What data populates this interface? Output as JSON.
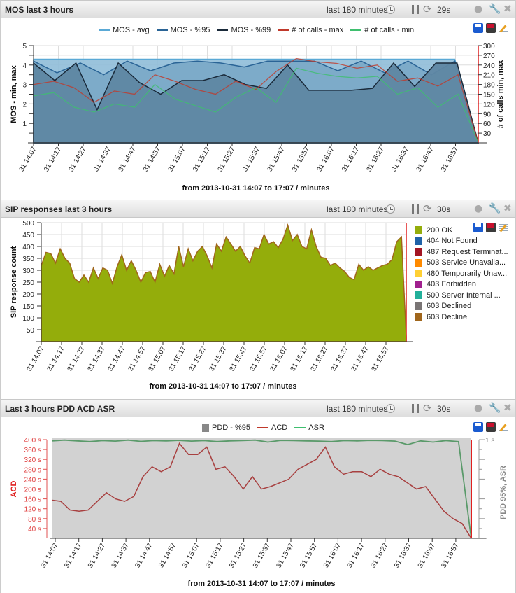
{
  "panels": [
    {
      "title": "MOS last 3 hours",
      "range_label": "last 180 minutes",
      "refresh_label": "29s"
    },
    {
      "title": "SIP responses last 3 hours",
      "range_label": "last 180 minutes",
      "refresh_label": "30s"
    },
    {
      "title": "Last 3 hours PDD ACD ASR",
      "range_label": "last 180 minutes",
      "refresh_label": "30s"
    }
  ],
  "chart_data": [
    {
      "type": "area",
      "title": "MOS last 3 hours",
      "xlabel": "from 2013-10-31 14:07 to 17:07 / minutes",
      "ylabel": "MOS - min, max",
      "y2label": "# of calls min, max",
      "ylim": [
        0,
        5
      ],
      "y2lim": [
        0,
        300
      ],
      "yticks": [
        "1",
        "2",
        "3",
        "4",
        "5"
      ],
      "y2ticks": [
        "30",
        "60",
        "90",
        "120",
        "150",
        "180",
        "210",
        "240",
        "270",
        "300"
      ],
      "categories": [
        "31 14:07",
        "31 14:17",
        "31 14:27",
        "31 14:37",
        "31 14:47",
        "31 14:57",
        "31 15:07",
        "31 15:17",
        "31 15:27",
        "31 15:37",
        "31 15:47",
        "31 15:57",
        "31 16:07",
        "31 16:17",
        "31 16:27",
        "31 16:37",
        "31 16:47",
        "31 16:57"
      ],
      "grid": true,
      "legend_position": "top",
      "series": [
        {
          "name": "MOS - avg",
          "color": "#5aa9d6",
          "axis": "left",
          "values": [
            4.3,
            4.3,
            4.3,
            4.3,
            4.3,
            4.3,
            4.3,
            4.3,
            4.3,
            4.3,
            4.3,
            4.3,
            4.3,
            4.3,
            4.3,
            4.3,
            4.3,
            4.3,
            4.3,
            0
          ]
        },
        {
          "name": "MOS - %95",
          "color": "#2a6496",
          "axis": "left",
          "values": [
            4.2,
            3.6,
            4.1,
            3.5,
            4.2,
            3.7,
            4.1,
            4.2,
            4.1,
            3.9,
            4.2,
            4.2,
            4.2,
            3.7,
            4.2,
            3.6,
            4.2,
            3.5,
            4.2,
            0
          ]
        },
        {
          "name": "MOS - %99",
          "color": "#1a2a3a",
          "axis": "left",
          "values": [
            4.1,
            3.2,
            4.1,
            1.7,
            4.1,
            3.1,
            2.5,
            3.2,
            3.2,
            3.5,
            3.0,
            2.8,
            4.0,
            2.7,
            2.7,
            2.7,
            2.8,
            4.1,
            2.9,
            4.1,
            4.1,
            0
          ]
        },
        {
          "name": "# of calls - max",
          "color": "#c0392b",
          "axis": "right",
          "values": [
            180,
            190,
            170,
            125,
            160,
            150,
            210,
            190,
            165,
            150,
            190,
            165,
            220,
            260,
            250,
            245,
            230,
            240,
            190,
            200,
            175,
            210,
            0
          ]
        },
        {
          "name": "# of calls - min",
          "color": "#3fbf6f",
          "axis": "right",
          "values": [
            145,
            155,
            110,
            95,
            120,
            110,
            180,
            135,
            115,
            95,
            140,
            170,
            125,
            230,
            215,
            205,
            200,
            205,
            150,
            170,
            110,
            150,
            0
          ]
        }
      ]
    },
    {
      "type": "area",
      "title": "SIP responses last 3 hours",
      "xlabel": "from 2013-10-31 14:07 to 17:07 / minutes",
      "ylabel": "SIP response count",
      "ylim": [
        0,
        500
      ],
      "yticks": [
        "50",
        "100",
        "150",
        "200",
        "250",
        "300",
        "350",
        "400",
        "450",
        "500"
      ],
      "categories": [
        "31 14:07",
        "31 14:17",
        "31 14:27",
        "31 14:37",
        "31 14:47",
        "31 14:57",
        "31 15:07",
        "31 15:17",
        "31 15:27",
        "31 15:37",
        "31 15:47",
        "31 15:57",
        "31 16:07",
        "31 16:17",
        "31 16:27",
        "31 16:37",
        "31 16:47",
        "31 16:57"
      ],
      "grid": true,
      "legend_position": "right",
      "series": [
        {
          "name": "200 OK",
          "color": "#94ad0b",
          "values": [
            320,
            375,
            370,
            330,
            390,
            350,
            330,
            265,
            250,
            280,
            250,
            310,
            265,
            310,
            300,
            245,
            315,
            365,
            300,
            340,
            300,
            250,
            290,
            295,
            250,
            325,
            275,
            320,
            285,
            400,
            315,
            390,
            340,
            380,
            400,
            360,
            310,
            410,
            380,
            440,
            410,
            380,
            400,
            360,
            330,
            395,
            390,
            450,
            410,
            420,
            395,
            430,
            490,
            425,
            450,
            400,
            390,
            470,
            400,
            355,
            350,
            320,
            330,
            310,
            295,
            270,
            260,
            325,
            300,
            315,
            300,
            310,
            320,
            325,
            345,
            420,
            440,
            20
          ]
        },
        {
          "name": "404 Not Found",
          "color": "#1f62a8",
          "values": []
        },
        {
          "name": "487 Request Terminat...",
          "color": "#a31524",
          "values": []
        },
        {
          "name": "503 Service Unavaila...",
          "color": "#ff8a00",
          "values": []
        },
        {
          "name": "480 Temporarily Unav...",
          "color": "#ffd034",
          "values": []
        },
        {
          "name": "403 Forbidden",
          "color": "#a0208e",
          "values": []
        },
        {
          "name": "500 Server Internal ...",
          "color": "#22b09a",
          "values": []
        },
        {
          "name": "603 Declined",
          "color": "#7a7575",
          "values": []
        },
        {
          "name": "603 Decline",
          "color": "#a0661c",
          "values": []
        }
      ]
    },
    {
      "type": "line",
      "title": "Last 3 hours PDD ACD ASR",
      "xlabel": "from 2013-10-31 14:07 to 17:07 / minutes",
      "ylabel": "ACD",
      "y2label": "PDD 95%, ASR",
      "ylim": [
        0,
        400
      ],
      "y2lim": [
        0,
        1
      ],
      "yticks": [
        "40 s",
        "80 s",
        "120 s",
        "160 s",
        "200 s",
        "240 s",
        "280 s",
        "320 s",
        "360 s",
        "400 s"
      ],
      "y2ticks": [
        "1 s"
      ],
      "categories": [
        "31 14:07",
        "31 14:17",
        "31 14:27",
        "31 14:37",
        "31 14:47",
        "31 14:57",
        "31 15:07",
        "31 15:17",
        "31 15:27",
        "31 15:37",
        "31 15:47",
        "31 15:57",
        "31 16:07",
        "31 16:17",
        "31 16:27",
        "31 16:37",
        "31 16:47",
        "31 16:57"
      ],
      "grid": false,
      "legend_position": "top",
      "series": [
        {
          "name": "PDD - %95",
          "color": "#888888",
          "values": [
            1,
            1,
            1,
            1,
            1,
            1,
            1,
            1,
            1,
            1,
            1,
            1,
            1,
            1,
            1,
            1,
            1,
            1,
            1,
            0
          ]
        },
        {
          "name": "ACD",
          "color": "#c0392b",
          "values": [
            155,
            150,
            115,
            110,
            115,
            150,
            185,
            160,
            150,
            170,
            250,
            290,
            270,
            290,
            385,
            340,
            340,
            370,
            280,
            290,
            250,
            200,
            250,
            200,
            210,
            225,
            240,
            280,
            300,
            320,
            370,
            290,
            260,
            270,
            270,
            250,
            280,
            260,
            250,
            225,
            200,
            210,
            160,
            110,
            80,
            60,
            0
          ]
        },
        {
          "name": "ASR",
          "color": "#3fbf6f",
          "values": [
            395,
            398,
            395,
            392,
            396,
            394,
            398,
            393,
            396,
            395,
            397,
            394,
            396,
            392,
            395,
            396,
            398,
            390,
            397,
            396,
            395,
            394,
            392,
            396,
            395,
            397,
            396,
            394,
            380,
            395,
            390,
            396,
            392,
            0
          ]
        }
      ]
    }
  ]
}
